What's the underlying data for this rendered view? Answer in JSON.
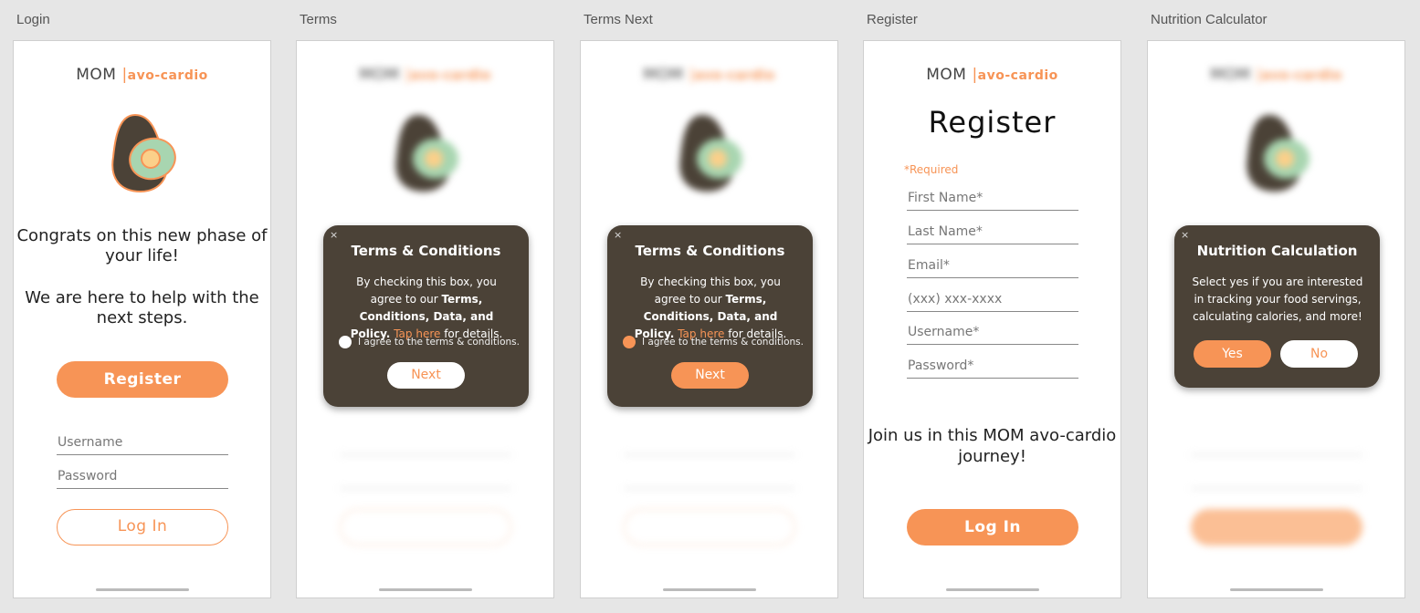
{
  "frames": {
    "login": {
      "label": "Login",
      "logo": {
        "mom": "MOM",
        "bar": "|",
        "brand": "avo-cardio"
      },
      "headline_1": "Congrats on this new phase of your life!",
      "headline_2": "We are here to help with the next steps.",
      "register_label": "Register",
      "username_placeholder": "Username",
      "password_placeholder": "Password",
      "login_label": "Log In"
    },
    "terms": {
      "label": "Terms",
      "close": "×",
      "title": "Terms & Conditions",
      "body_pre": "By checking this box, you agree to our ",
      "body_bold": "Terms, Conditions, Data, and Policy.",
      "body_link": "Tap here",
      "body_post": " for details.",
      "agree_label": "I agree to the terms & conditions.",
      "agree_checked": false,
      "next_label": "Next"
    },
    "terms_next": {
      "label": "Terms Next",
      "close": "×",
      "title": "Terms & Conditions",
      "body_pre": "By checking this box, you agree to our ",
      "body_bold": "Terms, Conditions, Data, and Policy.",
      "body_link": "Tap here",
      "body_post": " for details.",
      "agree_label": "I agree to the terms & conditions.",
      "agree_checked": true,
      "next_label": "Next"
    },
    "register": {
      "label": "Register",
      "logo": {
        "mom": "MOM",
        "bar": "|",
        "brand": "avo-cardio"
      },
      "title": "Register",
      "required_note": "*Required",
      "fields": [
        "First Name*",
        "Last Name*",
        "Email*",
        "(xxx) xxx-xxxx",
        "Username*",
        "Password*"
      ],
      "join_text": "Join us in this MOM avo-cardio journey!",
      "login_label": "Log In"
    },
    "nutrition": {
      "label": "Nutrition Calculator",
      "close": "×",
      "title": "Nutrition Calculation",
      "body": "Select yes if you are interested in tracking your food servings, calculating calories, and more!",
      "yes_label": "Yes",
      "no_label": "No"
    }
  },
  "colors": {
    "accent": "#f79456",
    "modal_bg": "#4b4237",
    "avocado_skin": "#4b4237",
    "avocado_flesh": "#a8d5b0",
    "avocado_pit": "#fbd08a"
  },
  "icons": [
    "avocado-icon",
    "close-icon",
    "radio-icon"
  ]
}
